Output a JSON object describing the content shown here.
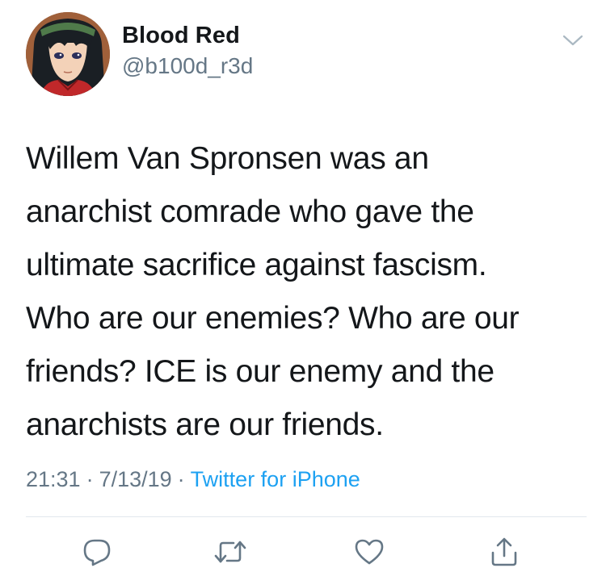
{
  "user": {
    "display_name": "Blood Red",
    "handle": "@b100d_r3d",
    "avatar_icon": "anime-character-avatar"
  },
  "tweet": {
    "lines": [
      "Willem Van Spronsen was an",
      "anarchist comrade who gave the",
      "ultimate sacrifice against fascism.",
      "Who are our enemies? Who are our",
      "friends? ICE is our enemy and the",
      "anarchists are our friends."
    ]
  },
  "meta": {
    "time": "21:31",
    "separator": "·",
    "date": "7/13/19",
    "source": "Twitter for iPhone"
  },
  "actions": {
    "reply_icon": "reply-icon",
    "retweet_icon": "retweet-icon",
    "like_icon": "like-icon",
    "share_icon": "share-icon"
  },
  "colors": {
    "text": "#14171a",
    "secondary": "#657786",
    "link": "#1da1f2",
    "divider": "#e1e8ed"
  }
}
